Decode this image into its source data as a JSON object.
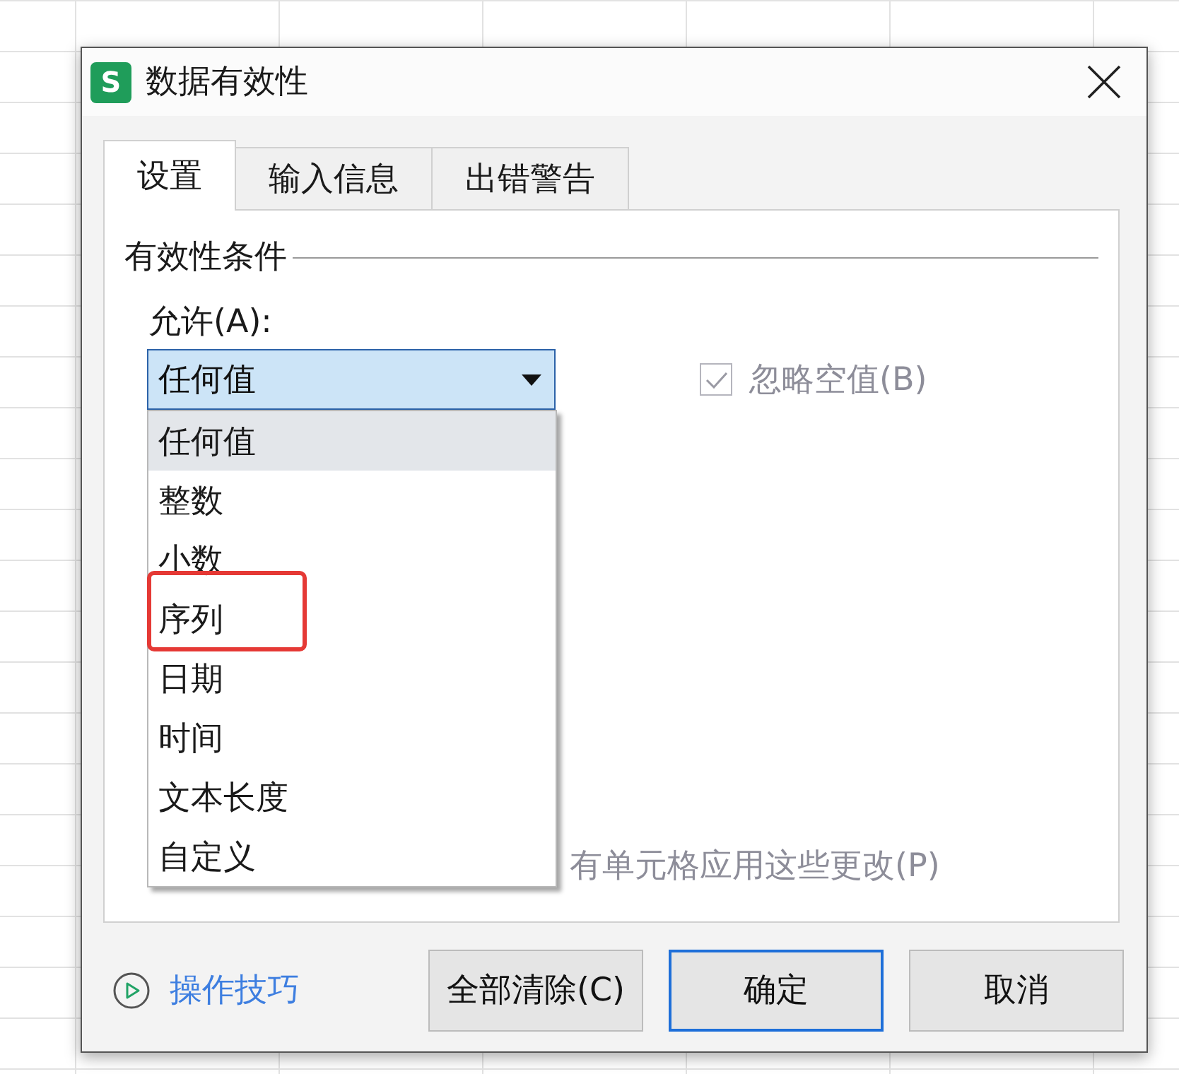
{
  "window": {
    "app_logo": "S",
    "title": "数据有效性"
  },
  "tabs": [
    {
      "label": "设置",
      "selected": true
    },
    {
      "label": "输入信息",
      "selected": false
    },
    {
      "label": "出错警告",
      "selected": false
    }
  ],
  "criteria": {
    "heading": "有效性条件",
    "allow_label": "允许(A):",
    "allow_value": "任何值",
    "expanded": true,
    "options": [
      {
        "label": "任何值",
        "selected": true,
        "highlighted": false
      },
      {
        "label": "整数",
        "selected": false,
        "highlighted": false
      },
      {
        "label": "小数",
        "selected": false,
        "highlighted": false
      },
      {
        "label": "序列",
        "selected": false,
        "highlighted": true
      },
      {
        "label": "日期",
        "selected": false,
        "highlighted": false
      },
      {
        "label": "时间",
        "selected": false,
        "highlighted": false
      },
      {
        "label": "文本长度",
        "selected": false,
        "highlighted": false
      },
      {
        "label": "自定义",
        "selected": false,
        "highlighted": false
      }
    ]
  },
  "ignore_blank": {
    "label": "忽略空值(B)",
    "checked": true,
    "disabled": true
  },
  "apply_to_all": {
    "label": "有单元格应用这些更改(P)",
    "disabled": true
  },
  "footer": {
    "tips_link": "操作技巧",
    "buttons": [
      {
        "label": "全部清除(C)",
        "default": false
      },
      {
        "label": "确定",
        "default": true
      },
      {
        "label": "取消",
        "default": false
      }
    ]
  }
}
